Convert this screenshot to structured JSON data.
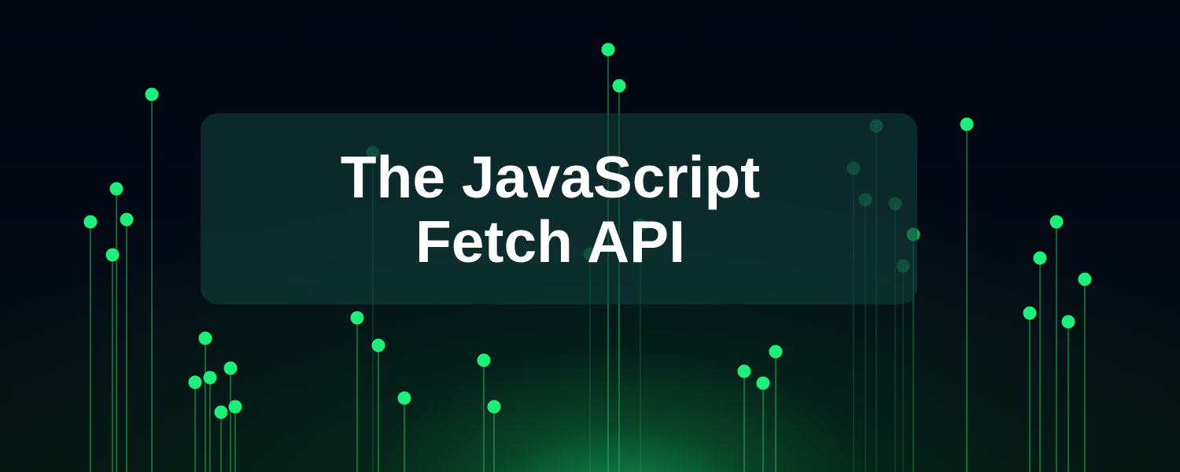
{
  "banner": {
    "title": "The JavaScript Fetch API",
    "colors": {
      "background": "#030812",
      "glow": "#10a050",
      "node": "#1cf07a",
      "line": "#1fae62",
      "card": "#14463e",
      "title_text": "#ffffff"
    },
    "decoration": "node-lines"
  }
}
